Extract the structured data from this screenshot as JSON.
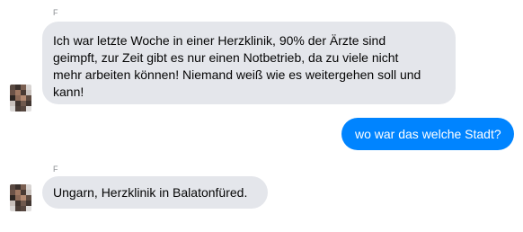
{
  "conversation": {
    "messages": [
      {
        "direction": "incoming",
        "sender": "F",
        "lines": [
          "Ich war letzte Woche in einer Herzklinik, 90% der Ärzte sind",
          "geimpft, zur Zeit gibt es nur einen Notbetrieb, da zu viele nicht",
          "mehr arbeiten können! Niemand weiß wie es weitergehen soll und",
          "kann!"
        ]
      },
      {
        "direction": "outgoing",
        "text": "wo war das welche Stadt?"
      },
      {
        "direction": "incoming",
        "sender": "F",
        "text": "Ungarn, Herzklinik in Balatonfüred."
      }
    ]
  },
  "colors": {
    "incoming_bubble": "#e4e6eb",
    "outgoing_bubble": "#0084ff",
    "sender_name": "#8a8d91"
  },
  "icons": {
    "avatar": "pixelated-profile-photo"
  }
}
